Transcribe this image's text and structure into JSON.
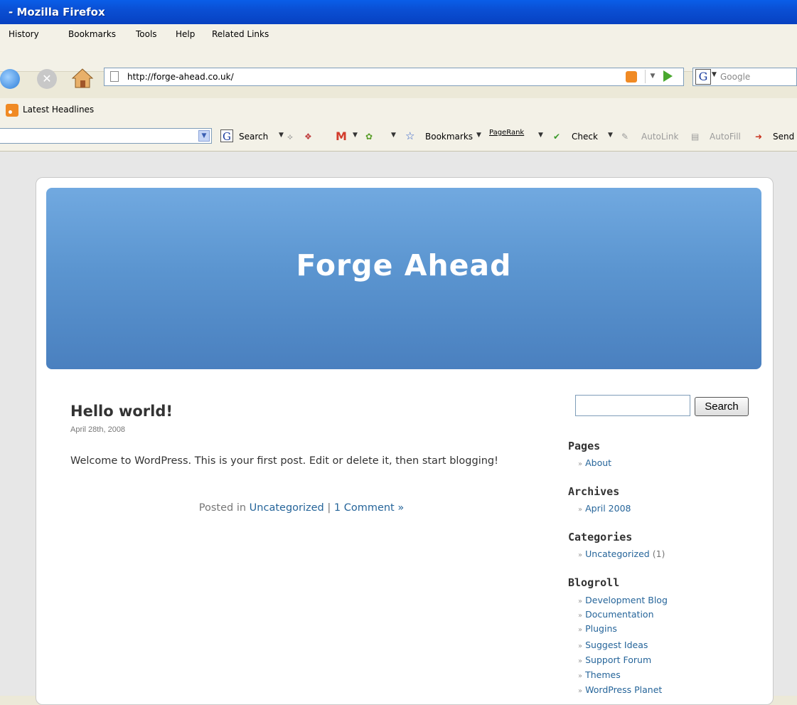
{
  "window": {
    "title": "- Mozilla Firefox"
  },
  "menu": [
    "History",
    "Bookmarks",
    "Tools",
    "Help",
    "Related Links"
  ],
  "nav": {
    "url": "http://forge-ahead.co.uk/",
    "search_placeholder": "Google"
  },
  "bookmarks": {
    "latest_headlines": "Latest Headlines"
  },
  "google_toolbar": {
    "search": "Search",
    "bookmarks": "Bookmarks",
    "pagerank": "PageRank",
    "check": "Check",
    "autolink": "AutoLink",
    "autofill": "AutoFill",
    "send": "Send"
  },
  "blog": {
    "site_title": "Forge Ahead",
    "post": {
      "title": "Hello world!",
      "date": "April 28th, 2008",
      "body": "Welcome to WordPress. This is your first post. Edit or delete it, then start blogging!",
      "posted_in": "Posted in",
      "category": "Uncategorized",
      "separator": "|",
      "comments": "1 Comment »"
    },
    "sidebar": {
      "search_button": "Search",
      "pages_title": "Pages",
      "pages": [
        "About"
      ],
      "archives_title": "Archives",
      "archives": [
        "April 2008"
      ],
      "categories_title": "Categories",
      "categories": [
        {
          "name": "Uncategorized",
          "count": "(1)"
        }
      ],
      "blogroll_title": "Blogroll",
      "blogroll": [
        "Development Blog",
        "Documentation",
        "Plugins",
        "Suggest Ideas",
        "Support Forum",
        "Themes",
        "WordPress Planet"
      ]
    }
  }
}
